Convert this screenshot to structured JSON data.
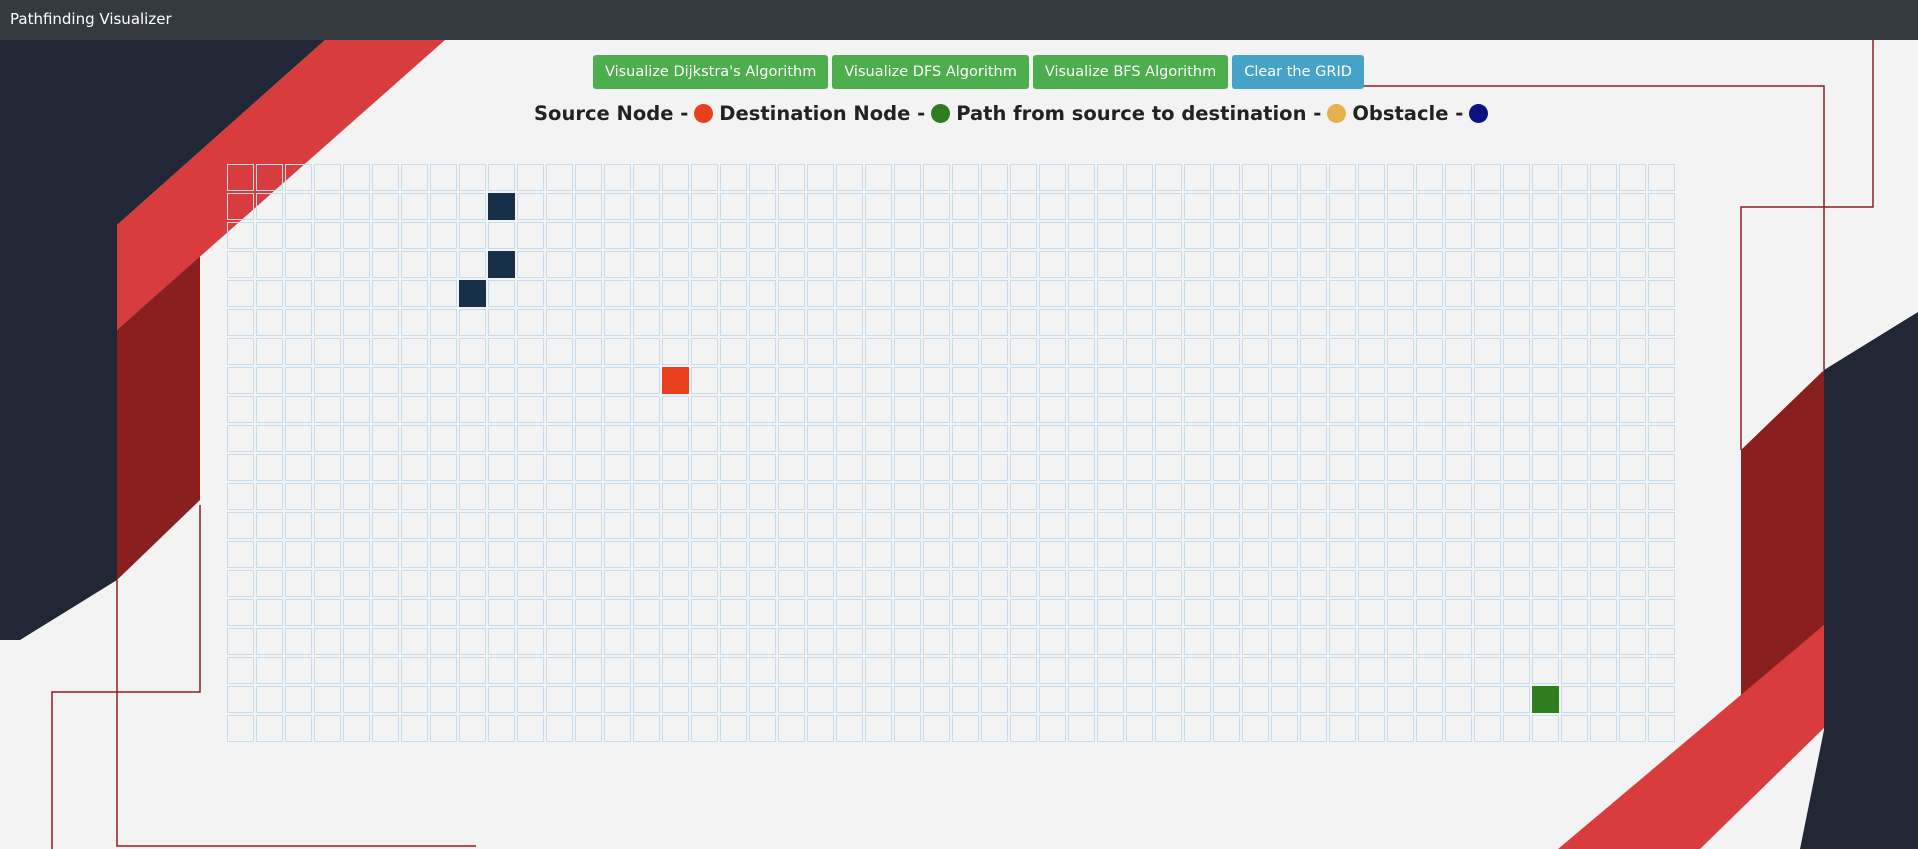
{
  "navbar": {
    "title": "Pathfinding Visualizer"
  },
  "buttons": [
    {
      "label": "Visualize Dijkstra's Algorithm",
      "style": "green"
    },
    {
      "label": "Visualize DFS Algorithm",
      "style": "green"
    },
    {
      "label": "Visualize BFS Algorithm",
      "style": "green"
    },
    {
      "label": "Clear the GRID",
      "style": "blue"
    }
  ],
  "legend": {
    "source_label": "Source Node -",
    "destination_label": "Destination Node -",
    "path_label": "Path from source to destination -",
    "obstacle_label": "Obstacle -"
  },
  "colors": {
    "navbar": "#343a40",
    "button_green": "#4cae4c",
    "button_blue": "#46a3c8",
    "legend_source": "#e8401c",
    "legend_destination": "#2e7d1e",
    "legend_path": "#e8b04b",
    "legend_obstacle": "#0d1280",
    "cell_border": "#c5dcef",
    "obstacle_cell": "#17304a",
    "source_cell": "#e8401c",
    "destination_cell": "#2e7d1e",
    "deco_dark": "#212735",
    "deco_red": "#d93c3c",
    "deco_dark_red": "#8a1f1f"
  },
  "grid": {
    "rows": 20,
    "cols": 50,
    "source": {
      "row": 7,
      "col": 15
    },
    "destination": {
      "row": 18,
      "col": 45
    },
    "obstacles": [
      {
        "row": 1,
        "col": 9
      },
      {
        "row": 3,
        "col": 9
      },
      {
        "row": 4,
        "col": 8
      }
    ]
  }
}
